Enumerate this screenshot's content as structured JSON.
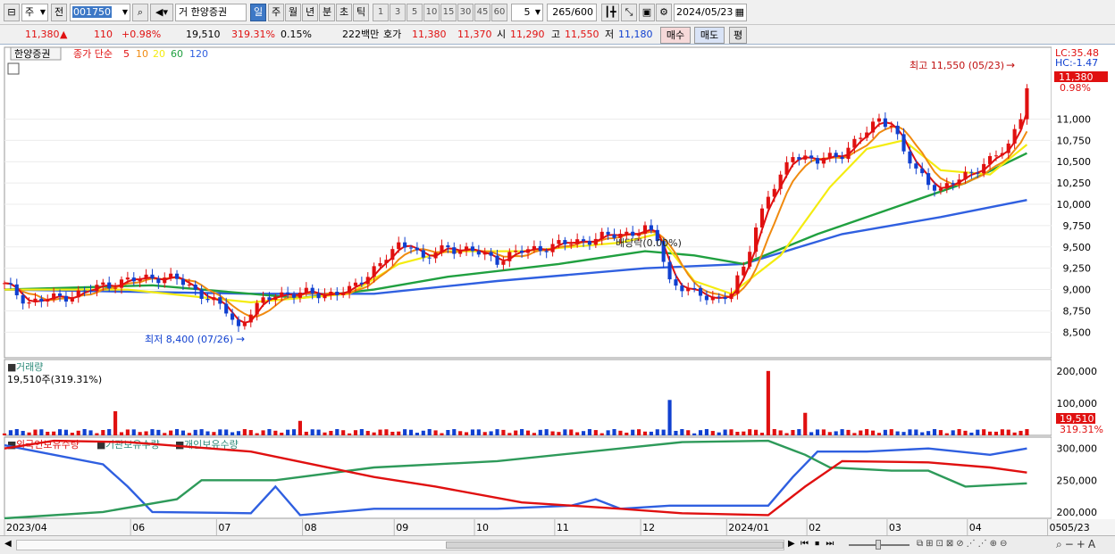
{
  "toolbar": {
    "market_label": "주",
    "prev_label": "전",
    "code": "001750",
    "stock_kind": "거",
    "stock_name": "한양증권",
    "periods": [
      "일",
      "주",
      "월",
      "년",
      "분",
      "초",
      "틱"
    ],
    "intervals": [
      "1",
      "3",
      "5",
      "10",
      "15",
      "30",
      "45",
      "60"
    ],
    "interval_value": "5",
    "count": "265",
    "count_max": "/600",
    "date": "2024/05/23"
  },
  "info": {
    "price": "11,380",
    "change_arrow": "▲",
    "change": "110",
    "change_pct": "+0.98%",
    "volume": "19,510",
    "volume_ratio": "319.31%",
    "turnover": "0.15%",
    "amount": "222백만",
    "quote_label": "호가",
    "ask": "11,380",
    "bid": "11,370",
    "open_label": "시",
    "open": "11,290",
    "high_label": "고",
    "high": "11,550",
    "low_label": "저",
    "low": "11,180",
    "buy_label": "매수",
    "sell_label": "매도",
    "eval_label": "평"
  },
  "colors": {
    "candle_up": "#e01010",
    "candle_down": "#1040d0",
    "ma5": "#e01010",
    "ma10": "#f08a10",
    "ma20": "#f4ec10",
    "ma60": "#20a040",
    "ma120": "#3060e0",
    "foreign": "#2f5fe0",
    "institution": "#2e9a5a",
    "individual": "#e01010",
    "price_tag": "#e01010"
  },
  "chart_data": [
    {
      "type": "line",
      "title": "한양증권",
      "price_legend": "종가 단순",
      "ma_periods": [
        "5",
        "10",
        "20",
        "60",
        "120"
      ],
      "y_ticks": [
        "11,000",
        "10,750",
        "10,500",
        "10,250",
        "10,000",
        "9,750",
        "9,500",
        "9,250",
        "9,000",
        "8,750",
        "8,500"
      ],
      "ylim": [
        8200,
        11800
      ],
      "lc_label": "LC:35.48",
      "hc_label": "HC:-1.47",
      "last_price": "11,380",
      "last_change_pct": "0.98%",
      "high_annotation": "최고 11,550 (05/23)",
      "low_annotation": "최저 8,400 (07/26)",
      "event_annotation": "배당락(0.00%)",
      "x_labels": [
        "2023/04",
        "06",
        "07",
        "08",
        "09",
        "10",
        "11",
        "12",
        "2024/01",
        "02",
        "03",
        "04",
        "05"
      ],
      "x_right_label": "05/23",
      "close_path": [
        [
          0,
          9050
        ],
        [
          4,
          8850
        ],
        [
          8,
          8900
        ],
        [
          12,
          8950
        ],
        [
          16,
          9050
        ],
        [
          20,
          9100
        ],
        [
          24,
          9150
        ],
        [
          28,
          9120
        ],
        [
          32,
          8950
        ],
        [
          36,
          8750
        ],
        [
          38,
          8550
        ],
        [
          40,
          8750
        ],
        [
          44,
          8950
        ],
        [
          48,
          8950
        ],
        [
          52,
          8950
        ],
        [
          56,
          8980
        ],
        [
          60,
          9250
        ],
        [
          64,
          9500
        ],
        [
          66,
          9550
        ],
        [
          68,
          9350
        ],
        [
          72,
          9500
        ],
        [
          76,
          9450
        ],
        [
          80,
          9350
        ],
        [
          84,
          9450
        ],
        [
          88,
          9500
        ],
        [
          92,
          9550
        ],
        [
          96,
          9600
        ],
        [
          100,
          9650
        ],
        [
          104,
          9700
        ],
        [
          106,
          9600
        ],
        [
          108,
          9100
        ],
        [
          112,
          8950
        ],
        [
          116,
          8900
        ],
        [
          118,
          8950
        ],
        [
          120,
          9250
        ],
        [
          122,
          9750
        ],
        [
          124,
          10100
        ],
        [
          126,
          10300
        ],
        [
          128,
          10600
        ],
        [
          132,
          10500
        ],
        [
          136,
          10600
        ],
        [
          140,
          10850
        ],
        [
          142,
          11000
        ],
        [
          144,
          10950
        ],
        [
          146,
          10600
        ],
        [
          148,
          10400
        ],
        [
          152,
          10150
        ],
        [
          156,
          10350
        ],
        [
          160,
          10500
        ],
        [
          163,
          10700
        ],
        [
          165,
          11050
        ],
        [
          166,
          11380
        ]
      ],
      "ma_paths": {
        "ma20": [
          [
            0,
            9000
          ],
          [
            20,
            9000
          ],
          [
            40,
            8850
          ],
          [
            56,
            8950
          ],
          [
            64,
            9300
          ],
          [
            72,
            9450
          ],
          [
            84,
            9450
          ],
          [
            100,
            9550
          ],
          [
            106,
            9650
          ],
          [
            112,
            9100
          ],
          [
            118,
            8950
          ],
          [
            126,
            9400
          ],
          [
            134,
            10200
          ],
          [
            140,
            10650
          ],
          [
            146,
            10750
          ],
          [
            152,
            10400
          ],
          [
            160,
            10350
          ],
          [
            166,
            10700
          ]
        ],
        "ma60": [
          [
            0,
            9000
          ],
          [
            24,
            9050
          ],
          [
            48,
            8900
          ],
          [
            60,
            9000
          ],
          [
            72,
            9150
          ],
          [
            90,
            9300
          ],
          [
            104,
            9450
          ],
          [
            112,
            9400
          ],
          [
            120,
            9300
          ],
          [
            132,
            9650
          ],
          [
            146,
            10000
          ],
          [
            156,
            10250
          ],
          [
            166,
            10600
          ]
        ],
        "ma120": [
          [
            0,
            9000
          ],
          [
            40,
            8950
          ],
          [
            60,
            8950
          ],
          [
            80,
            9100
          ],
          [
            104,
            9250
          ],
          [
            120,
            9300
          ],
          [
            136,
            9650
          ],
          [
            152,
            9850
          ],
          [
            166,
            10050
          ]
        ]
      }
    },
    {
      "type": "bar",
      "title": "거래량",
      "summary": "19,510주(319.31%)",
      "y_ticks": [
        "200,000",
        "100,000"
      ],
      "ylim": [
        0,
        230000
      ],
      "last_value": "19,510",
      "last_pct": "319.31%",
      "spikes": [
        [
          18,
          75000
        ],
        [
          48,
          45000
        ],
        [
          108,
          110000
        ],
        [
          124,
          200000
        ],
        [
          130,
          70000
        ]
      ],
      "base_level": 15000
    },
    {
      "type": "line",
      "series_labels": [
        "외국인보유수량",
        "기관보유수량",
        "개인보유수량"
      ],
      "y_ticks": [
        "300,000",
        "250,000",
        "200,000"
      ],
      "ylim": [
        190000,
        315000
      ],
      "series": [
        {
          "name": "외국인보유수량",
          "values": [
            [
              0,
              305000
            ],
            [
              16,
              275000
            ],
            [
              20,
              240000
            ],
            [
              24,
              200000
            ],
            [
              40,
              198000
            ],
            [
              44,
              240000
            ],
            [
              48,
              195000
            ],
            [
              60,
              205000
            ],
            [
              80,
              205000
            ],
            [
              92,
              210000
            ],
            [
              96,
              220000
            ],
            [
              100,
              205000
            ],
            [
              108,
              210000
            ],
            [
              124,
              210000
            ],
            [
              128,
              255000
            ],
            [
              132,
              295000
            ],
            [
              140,
              295000
            ],
            [
              150,
              300000
            ],
            [
              160,
              290000
            ],
            [
              166,
              300000
            ]
          ]
        },
        {
          "name": "기관보유수량",
          "values": [
            [
              0,
              190000
            ],
            [
              16,
              200000
            ],
            [
              28,
              220000
            ],
            [
              32,
              250000
            ],
            [
              44,
              250000
            ],
            [
              60,
              270000
            ],
            [
              80,
              280000
            ],
            [
              100,
              300000
            ],
            [
              110,
              310000
            ],
            [
              124,
              312000
            ],
            [
              130,
              290000
            ],
            [
              134,
              270000
            ],
            [
              144,
              265000
            ],
            [
              150,
              265000
            ],
            [
              156,
              240000
            ],
            [
              166,
              245000
            ]
          ]
        },
        {
          "name": "개인보유수량",
          "values": [
            [
              0,
              300000
            ],
            [
              8,
              312000
            ],
            [
              20,
              310000
            ],
            [
              40,
              295000
            ],
            [
              60,
              255000
            ],
            [
              70,
              240000
            ],
            [
              84,
              215000
            ],
            [
              100,
              205000
            ],
            [
              110,
              198000
            ],
            [
              124,
              195000
            ],
            [
              130,
              240000
            ],
            [
              136,
              280000
            ],
            [
              150,
              278000
            ],
            [
              160,
              270000
            ],
            [
              166,
              262000
            ]
          ]
        }
      ]
    }
  ]
}
